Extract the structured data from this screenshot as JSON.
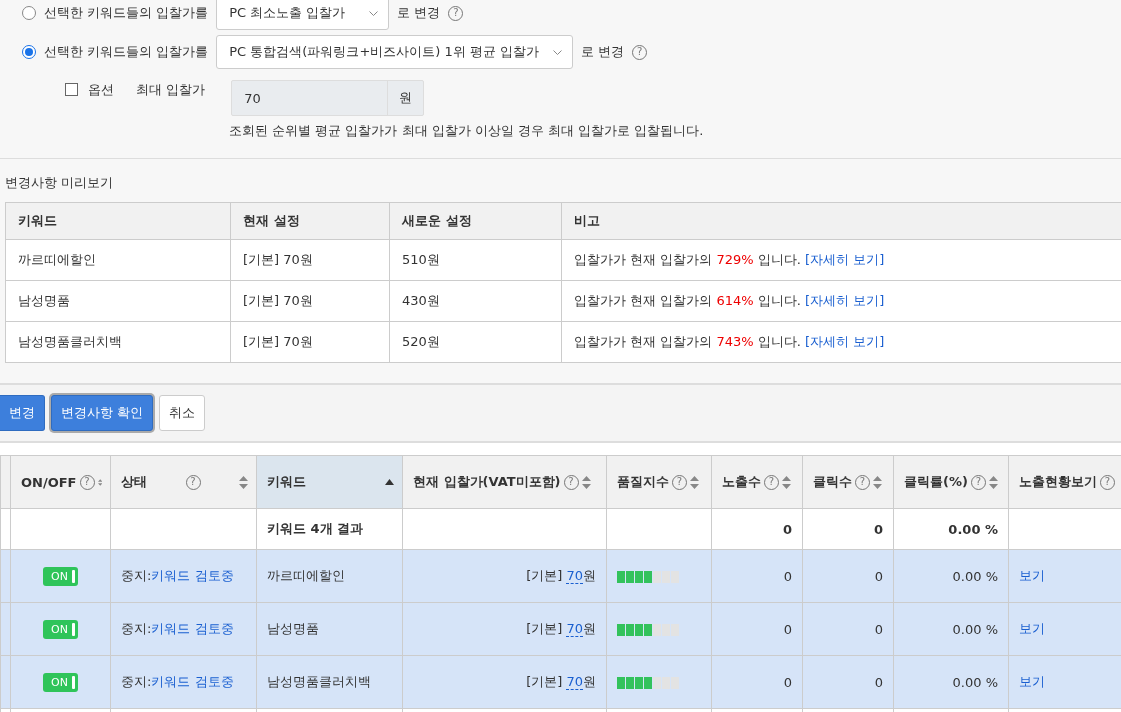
{
  "bid_options": [
    {
      "label": "선택한 키워드들의 입찰가를",
      "selected": false,
      "select_value": "PC 최소노출 입찰가",
      "suffix": "로 변경",
      "help": "?"
    },
    {
      "label": "선택한 키워드들의 입찰가를",
      "selected": true,
      "select_value": "PC 통합검색(파워링크+비즈사이트) 1위 평균 입찰가",
      "suffix": "로 변경",
      "help": "?"
    }
  ],
  "max_bid": {
    "checkbox_label": "옵션",
    "checked": false,
    "label": "최대 입찰가",
    "value": "70",
    "unit": "원",
    "note": "조회된 순위별 평균 입찰가가 최대 입찰가 이상일 경우 최대 입찰가로 입찰됩니다."
  },
  "preview": {
    "title": "변경사항 미리보기",
    "columns": [
      "키워드",
      "현재 설정",
      "새로운 설정",
      "비고"
    ],
    "rows": [
      {
        "keyword": "까르띠에할인",
        "current": "[기본] 70원",
        "new": "510원",
        "remark": "입찰가가 현재 입찰가의",
        "percent": "729%",
        "remark_end": "입니다.",
        "link": "[자세히 보기]"
      },
      {
        "keyword": "남성명품",
        "current": "[기본] 70원",
        "new": "430원",
        "remark": "입찰가가 현재 입찰가의",
        "percent": "614%",
        "remark_end": "입니다.",
        "link": "[자세히 보기]"
      },
      {
        "keyword": "남성명품클러치백",
        "current": "[기본] 70원",
        "new": "520원",
        "remark": "입찰가가 현재 입찰가의",
        "percent": "743%",
        "remark_end": "입니다.",
        "link": "[자세히 보기]"
      }
    ]
  },
  "buttons": [
    {
      "label": "변경",
      "kind": "primary"
    },
    {
      "label": "변경사항 확인",
      "kind": "focused"
    },
    {
      "label": "취소",
      "kind": "plain"
    }
  ],
  "table": {
    "columns": [
      {
        "label": "ON/OFF",
        "help": "?",
        "sortable": true,
        "sorted": false
      },
      {
        "label": "상태",
        "help": "?",
        "sortable": true,
        "sorted": false
      },
      {
        "label": "키워드",
        "sortable": true,
        "sorted": true
      },
      {
        "label": "현재 입찰가(VAT미포함)",
        "help": "?",
        "sortable": true,
        "sorted": false
      },
      {
        "label": "품질지수",
        "help": "?",
        "sortable": true,
        "sorted": false
      },
      {
        "label": "노출수",
        "help": "?",
        "sortable": true,
        "sorted": false
      },
      {
        "label": "클릭수",
        "help": "?",
        "sortable": true,
        "sorted": false
      },
      {
        "label": "클릭률(%)",
        "help": "?",
        "sortable": true,
        "sorted": false
      },
      {
        "label": "노출현황보기",
        "help": "?",
        "sortable": false,
        "sorted": false
      }
    ],
    "summary": {
      "keyword": "키워드 4개 결과",
      "impressions": "0",
      "clicks": "0",
      "ctr": "0.00 %"
    },
    "rows": [
      {
        "selected": true,
        "on": true,
        "toggle": "ON",
        "status": "중지:",
        "status_link": "키워드 검토중",
        "keyword": "까르띠에할인",
        "bid_prefix": "[기본]",
        "bid": "70",
        "bid_unit": "원",
        "level": 0.571,
        "impressions": "0",
        "clicks": "0",
        "ctr": "0.00 %",
        "view": "보기"
      },
      {
        "selected": true,
        "on": true,
        "toggle": "ON",
        "status": "중지:",
        "status_link": "키워드 검토중",
        "keyword": "남성명품",
        "bid_prefix": "[기본]",
        "bid": "70",
        "bid_unit": "원",
        "level": 0.571,
        "impressions": "0",
        "clicks": "0",
        "ctr": "0.00 %",
        "view": "보기"
      },
      {
        "selected": true,
        "on": true,
        "toggle": "ON",
        "status": "중지:",
        "status_link": "키워드 검토중",
        "keyword": "남성명품클러치백",
        "bid_prefix": "[기본]",
        "bid": "70",
        "bid_unit": "원",
        "level": 0.571,
        "impressions": "0",
        "clicks": "0",
        "ctr": "0.00 %",
        "view": "보기"
      }
    ]
  }
}
